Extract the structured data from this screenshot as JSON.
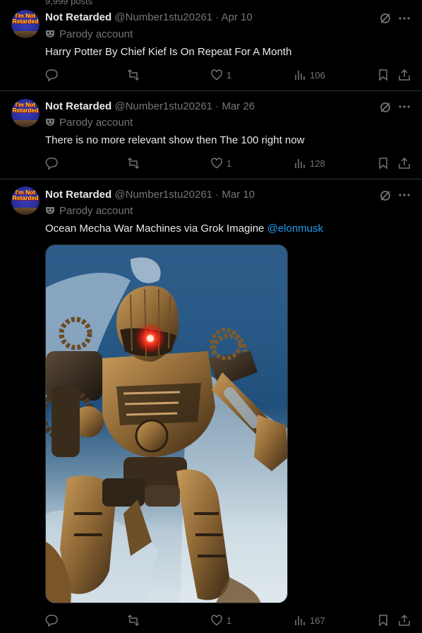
{
  "top_cut_text": "9,999 posts",
  "tweets": [
    {
      "avatar_text": "I'm Not Retarded",
      "name": "Not Retarded",
      "handle": "@Number1stu20261",
      "separator": "·",
      "date": "Apr 10",
      "label": "Parody account",
      "text": "Harry Potter By Chief Kief Is On Repeat For A Month",
      "mention": "",
      "replies": "",
      "reposts": "",
      "likes": "1",
      "views": "106"
    },
    {
      "avatar_text": "I'm Not Retarded",
      "name": "Not Retarded",
      "handle": "@Number1stu20261",
      "separator": "·",
      "date": "Mar 26",
      "label": "Parody account",
      "text": "There is no more relevant show then The 100 right now",
      "mention": "",
      "replies": "",
      "reposts": "",
      "likes": "1",
      "views": "128"
    },
    {
      "avatar_text": "I'm Not Retarded",
      "name": "Not Retarded",
      "handle": "@Number1stu20261",
      "separator": "·",
      "date": "Mar 10",
      "label": "Parody account",
      "text": "Ocean Mecha War Machines via Grok Imagine ",
      "mention": "@elonmusk",
      "replies": "",
      "reposts": "",
      "likes": "1",
      "views": "167"
    }
  ],
  "icons": {
    "reply": "reply-icon",
    "repost": "repost-icon",
    "like": "like-icon",
    "views": "views-icon",
    "bookmark": "bookmark-icon",
    "share": "share-icon",
    "grok": "grok-icon",
    "more": "more-icon",
    "parody": "parody-mask-icon"
  },
  "colors": {
    "background": "#000000",
    "text": "#e7e9ea",
    "muted": "#71767b",
    "link": "#1d9bf0",
    "divider": "#2f3336"
  }
}
